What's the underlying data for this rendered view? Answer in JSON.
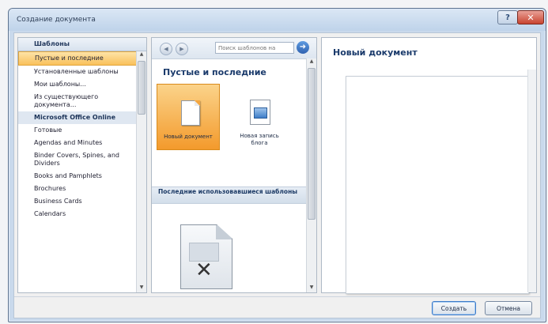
{
  "window": {
    "title": "Создание документа"
  },
  "title_buttons": {
    "help": "?",
    "close": "✕"
  },
  "sidebar": {
    "header": "Шаблоны",
    "items": [
      {
        "label": "Пустые и последние",
        "selected": true
      },
      {
        "label": "Установленные шаблоны"
      },
      {
        "label": "Мои шаблоны..."
      },
      {
        "label": "Из существующего документа..."
      },
      {
        "label": "Microsoft Office Online",
        "group": true
      },
      {
        "label": "Готовые"
      },
      {
        "label": "Agendas and Minutes"
      },
      {
        "label": "Binder Covers, Spines, and Dividers"
      },
      {
        "label": "Books and Pamphlets"
      },
      {
        "label": "Brochures"
      },
      {
        "label": "Business Cards"
      },
      {
        "label": "Calendars"
      }
    ]
  },
  "middle": {
    "search": {
      "placeholder": "Поиск шаблонов на"
    },
    "heading": "Пустые и последние",
    "tiles": [
      {
        "label": "Новый документ",
        "icon": "blank-document-icon",
        "selected": true
      },
      {
        "label": "Новая запись блога",
        "icon": "blog-post-icon"
      }
    ],
    "recent_section": "Последние использовавшиеся шаблоны",
    "recent_icon": "missing-template-icon"
  },
  "preview": {
    "title": "Новый документ"
  },
  "buttons": {
    "create": "Создать",
    "cancel": "Отмена"
  },
  "colors": {
    "accent": "#f9c15b",
    "heading": "#1a3a6b",
    "close": "#c8432f"
  }
}
